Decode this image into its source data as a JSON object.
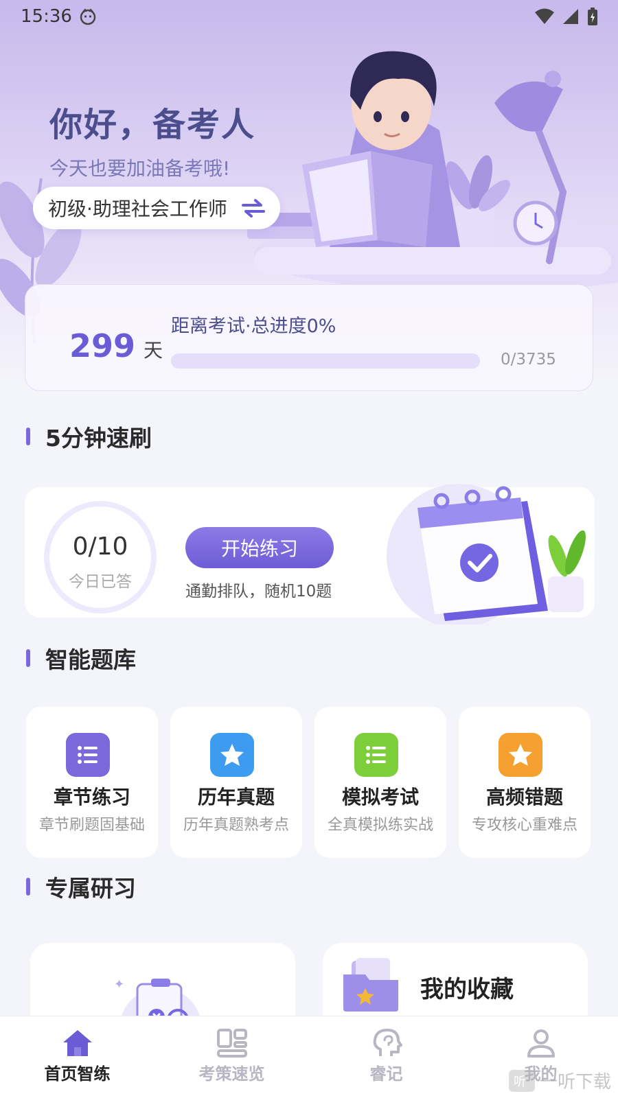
{
  "status_bar": {
    "time": "15:36"
  },
  "greeting": {
    "title": "你好，备考人",
    "subtitle": "今天也要加油备考哦!"
  },
  "exam_selector": {
    "label": "初级·助理社会工作师"
  },
  "progress": {
    "days": "299",
    "days_unit": "天",
    "label": "距离考试·总进度0%",
    "percent": 0,
    "count": "0/3735"
  },
  "quick_practice": {
    "section_title": "5分钟速刷",
    "answered": "0/10",
    "answered_label": "今日已答",
    "start_label": "开始练习",
    "description": "通勤排队，随机10题"
  },
  "question_bank": {
    "section_title": "智能题库",
    "items": [
      {
        "name": "章节练习",
        "desc": "章节刷题固基础",
        "icon": "list-icon",
        "color": "#7b69dc"
      },
      {
        "name": "历年真题",
        "desc": "历年真题熟考点",
        "icon": "star-icon",
        "color": "#3d9bf0"
      },
      {
        "name": "模拟考试",
        "desc": "全真模拟练实战",
        "icon": "list-icon",
        "color": "#7ccf3a"
      },
      {
        "name": "高频错题",
        "desc": "专攻核心重难点",
        "icon": "star-icon",
        "color": "#f5a030"
      }
    ]
  },
  "exclusive_study": {
    "section_title": "专属研习",
    "favorites_label": "我的收藏"
  },
  "tabbar": {
    "tabs": [
      {
        "label": "首页智练",
        "icon": "home-icon",
        "active": true
      },
      {
        "label": "考策速览",
        "icon": "grid-icon",
        "active": false
      },
      {
        "label": "睿记",
        "icon": "brain-icon",
        "active": false
      },
      {
        "label": "我的",
        "icon": "user-icon",
        "active": false
      }
    ]
  },
  "watermark": {
    "text": "一听下载"
  },
  "colors": {
    "accent": "#7b69dc",
    "title_dark": "#4b4d8c"
  }
}
